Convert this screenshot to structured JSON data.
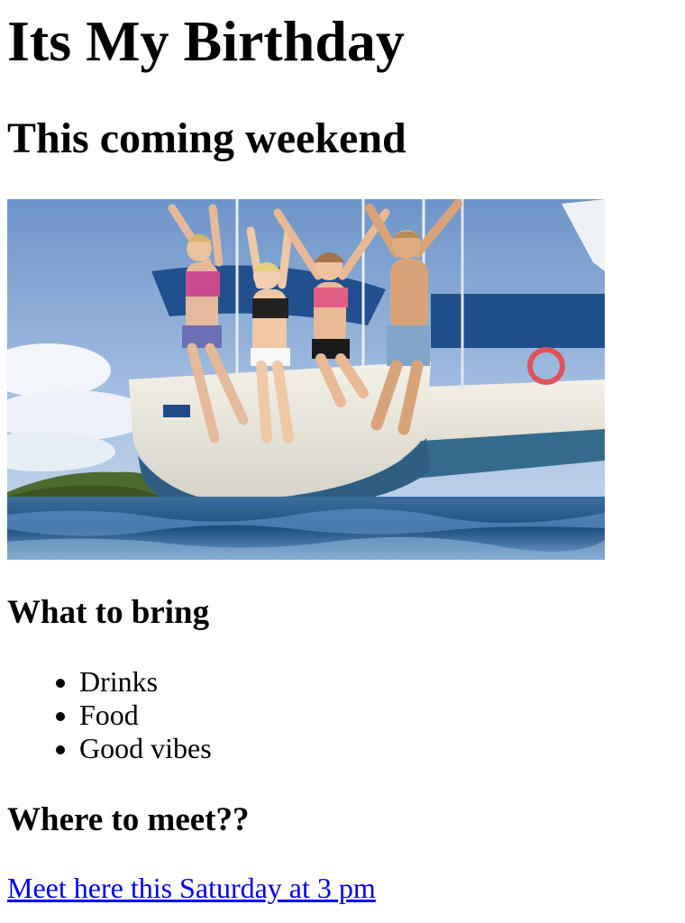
{
  "page": {
    "title": "Its My Birthday",
    "subtitle": "This coming weekend"
  },
  "hero_image": {
    "icon": "party-photo"
  },
  "bring": {
    "heading": "What to bring",
    "items": [
      "Drinks",
      "Food",
      "Good vibes"
    ]
  },
  "meet": {
    "heading": "Where to meet??",
    "link_text": "Meet here this Saturday at 3 pm"
  },
  "colors": {
    "link": "#0000ee",
    "text": "#000000",
    "background": "#ffffff"
  }
}
